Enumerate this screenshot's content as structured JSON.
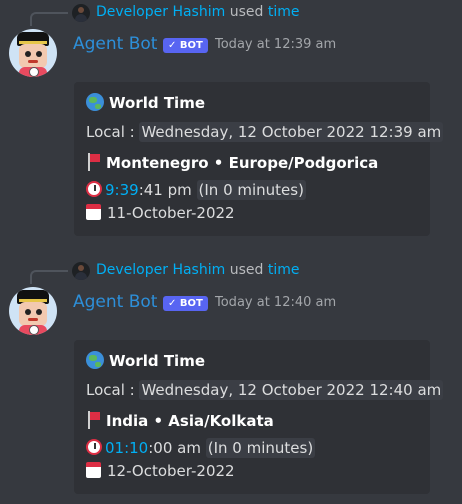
{
  "messages": [
    {
      "reply": {
        "user": "Developer Hashim",
        "used": "used",
        "command": "time"
      },
      "author": {
        "name": "Agent Bot",
        "badge": "✓ BOT",
        "timestamp": "Today at 12:39 am"
      },
      "embed": {
        "title": "World Time",
        "local_label": "Local :",
        "local_value": "Wednesday, 12 October 2022 12:39 am",
        "location": "Montenegro • Europe/Podgorica",
        "time_link": "9:39",
        "time_rest": ":41 pm",
        "relative": "(In 0 minutes)",
        "date": "11-October-2022"
      }
    },
    {
      "reply": {
        "user": "Developer Hashim",
        "used": "used",
        "command": "time"
      },
      "author": {
        "name": "Agent Bot",
        "badge": "✓ BOT",
        "timestamp": "Today at 12:40 am"
      },
      "embed": {
        "title": "World Time",
        "local_label": "Local :",
        "local_value": "Wednesday, 12 October 2022 12:40 am",
        "location": "India • Asia/Kolkata",
        "time_link": "01:10",
        "time_rest": ":00 am",
        "relative": "(In 0 minutes)",
        "date": "12-October-2022"
      }
    }
  ],
  "colors": {
    "background": "#36393f",
    "embed_bg": "#2f3136",
    "link": "#00aff4",
    "username": "#2d8fd9",
    "badge": "#5865f2"
  }
}
